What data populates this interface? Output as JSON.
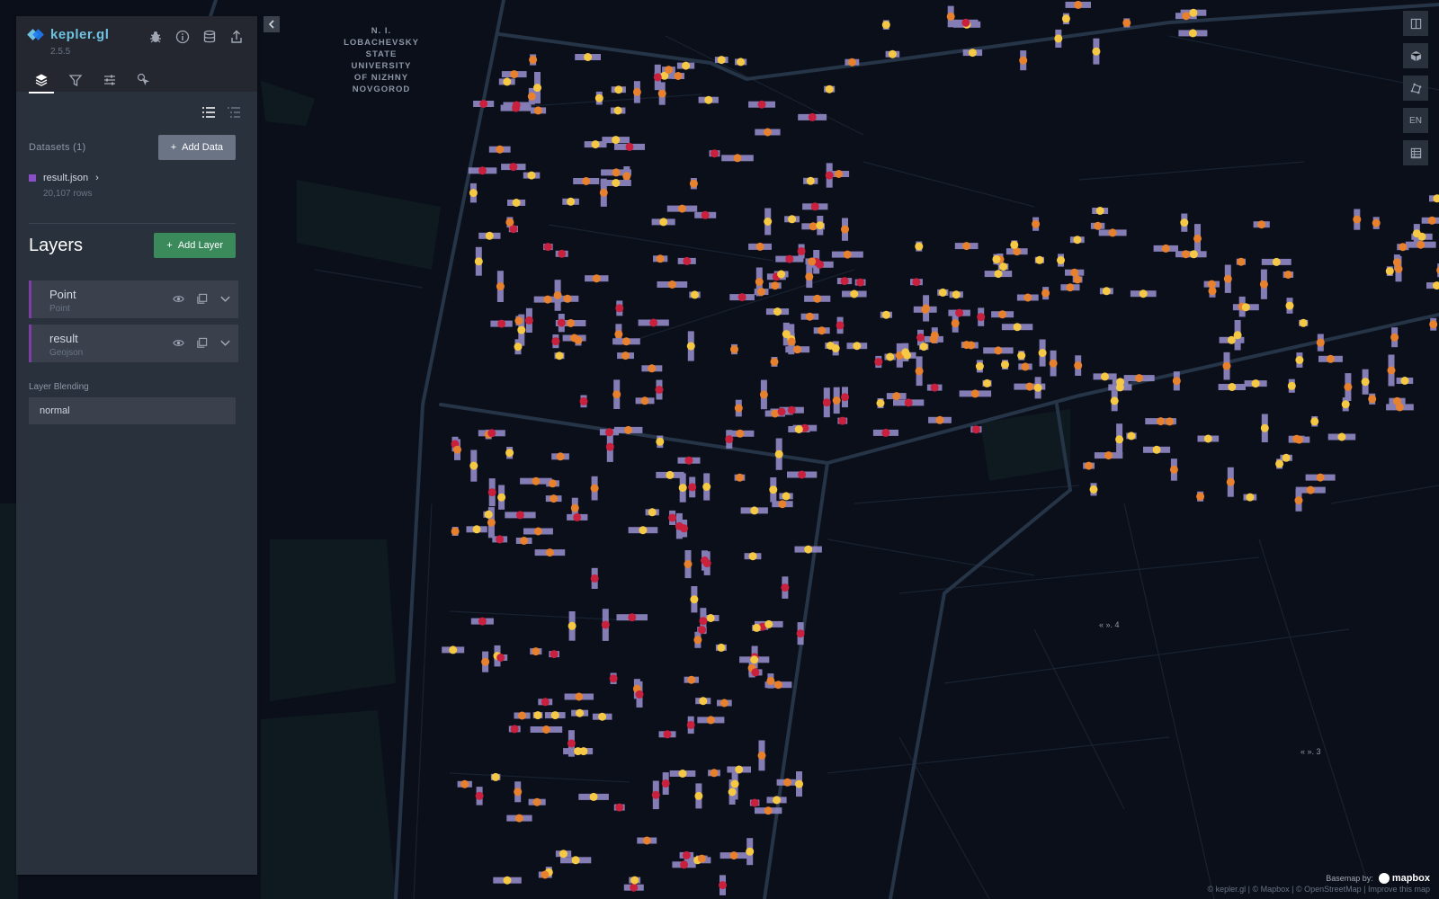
{
  "app": {
    "name": "kepler.gl",
    "version": "2.5.5"
  },
  "header_icons": [
    "bug-icon",
    "info-icon",
    "database-icon",
    "share-icon"
  ],
  "tabs": [
    {
      "name": "layers",
      "active": true
    },
    {
      "name": "filters",
      "active": false
    },
    {
      "name": "interactions",
      "active": false
    },
    {
      "name": "base-map",
      "active": false
    }
  ],
  "datasets": {
    "title": "Datasets (1)",
    "add_label": "Add Data",
    "items": [
      {
        "name": "result.json",
        "rows": "20,107 rows",
        "color": "#8a4fc7"
      }
    ]
  },
  "layers": {
    "title": "Layers",
    "add_label": "Add Layer",
    "items": [
      {
        "name": "Point",
        "type": "Point"
      },
      {
        "name": "result",
        "type": "Geojson"
      }
    ]
  },
  "blending": {
    "label": "Layer Blending",
    "value": "normal"
  },
  "map": {
    "place_label": [
      "N. I. LOBACHEVSKY",
      "STATE",
      "UNIVERSITY",
      "OF NIZHNY",
      "NOVGOROD"
    ],
    "street_labels": [
      "« ». 4",
      "« ». 3"
    ],
    "controls": [
      "split-map-icon",
      "3d-view-icon",
      "draw-icon",
      "EN",
      "data-table-icon"
    ],
    "basemap_label": "Basemap by:",
    "basemap_brand": "mapbox",
    "attribution": "© kepler.gl | © Mapbox | © OpenStreetMap | Improve this map"
  },
  "colors": {
    "panel": "#29323c",
    "header": "#242730",
    "accent": "#6fc3e0",
    "add_data": "#6a7485",
    "add_layer": "#3a8a5b",
    "layer_border": "#7e3ea6",
    "map_bg": "#0b0f1a",
    "road": "#2a3a4c",
    "building": "#9a8fcf"
  }
}
